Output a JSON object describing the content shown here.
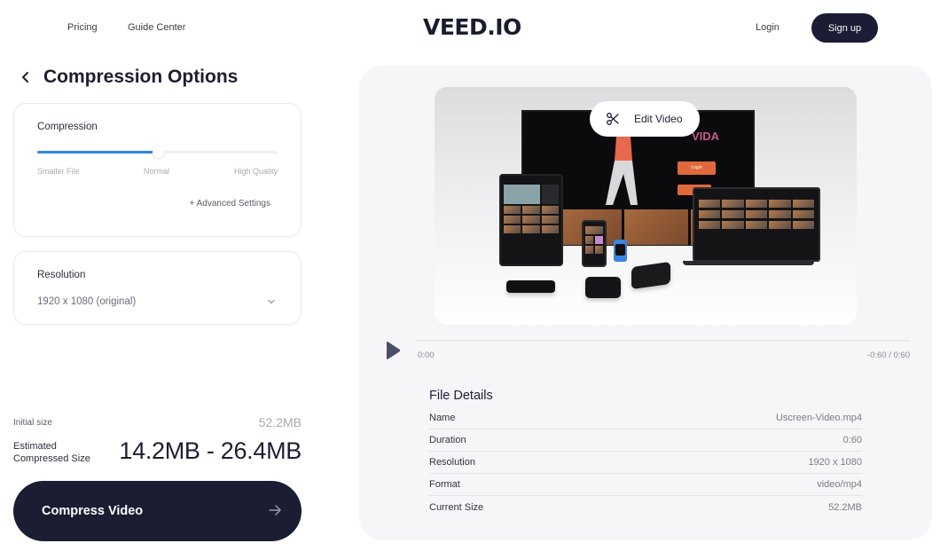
{
  "nav": {
    "links": [
      "Pricing",
      "Guide Center"
    ],
    "logo": "VEED.IO",
    "login": "Login",
    "signup": "Sign up"
  },
  "page": {
    "title": "Compression Options"
  },
  "compression": {
    "label": "Compression",
    "slider_value_fraction": 0.5,
    "slider_labels": [
      "Smaller File",
      "Normal",
      "High Quality"
    ],
    "advanced_settings": "+ Advanced Settings",
    "accent_color": "#2e88e0"
  },
  "resolution": {
    "label": "Resolution",
    "selected": "1920 x 1080 (original)"
  },
  "sizes": {
    "initial_label": "Initial size",
    "initial_value": "52.2MB",
    "estimated_label_line1": "Estimated",
    "estimated_label_line2": "Compressed Size",
    "estimated_value": "14.2MB - 26.4MB"
  },
  "compress_button": {
    "label": "Compress Video",
    "icon": "arrow-right-icon",
    "color": "#1b1d33"
  },
  "video": {
    "edit_label": "Edit Video",
    "edit_icon": "scissors-icon",
    "preview_brand": "VIDA",
    "preview_login": "Login",
    "time_current": "0:00",
    "time_remaining_total": "-0:60 / 0:60",
    "progress_fraction": 0
  },
  "file_details": {
    "title": "File Details",
    "rows": [
      {
        "key": "Name",
        "value": "Uscreen-Video.mp4"
      },
      {
        "key": "Duration",
        "value": "0:60"
      },
      {
        "key": "Resolution",
        "value": "1920 x 1080"
      },
      {
        "key": "Format",
        "value": "video/mp4"
      },
      {
        "key": "Current Size",
        "value": "52.2MB"
      }
    ]
  }
}
